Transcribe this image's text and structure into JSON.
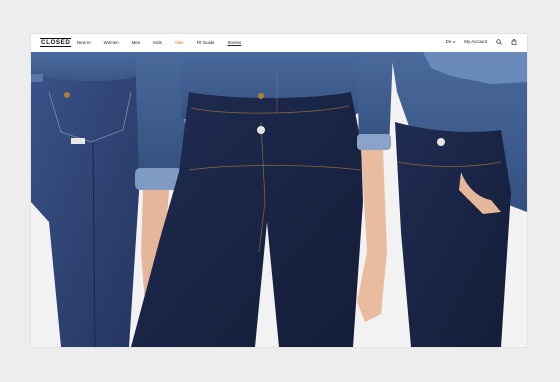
{
  "brand": {
    "logo_text": "CLOSED"
  },
  "nav": {
    "items": [
      {
        "label": "New In"
      },
      {
        "label": "Women"
      },
      {
        "label": "Men"
      },
      {
        "label": "Kids"
      },
      {
        "label": "Sale",
        "color": "#e07a1f"
      },
      {
        "label": "Fit Guide"
      },
      {
        "label": "Stories"
      }
    ]
  },
  "utility": {
    "language": "De",
    "account": "My Account",
    "icons": [
      "chevron-down-icon",
      "search-icon",
      "bag-icon"
    ]
  },
  "hero": {
    "image": "three models in dark denim jeans and denim shirts",
    "colors": {
      "denim_dark": "#1b2748",
      "denim_mid": "#2e4272",
      "shirt": "#3a5a8c",
      "skin": "#e8b99c"
    }
  }
}
